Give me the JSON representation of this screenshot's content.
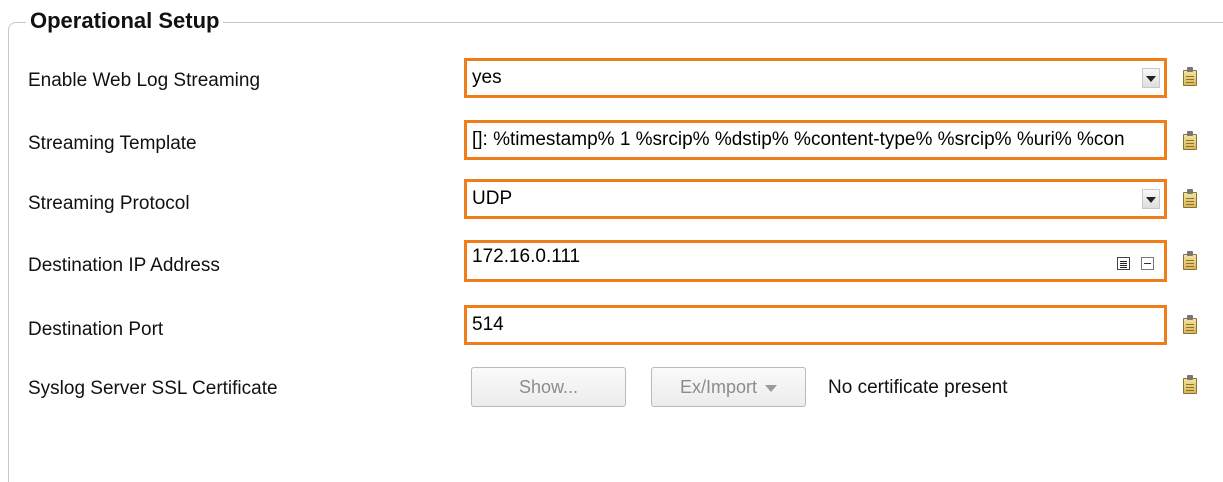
{
  "section": {
    "title": "Operational Setup"
  },
  "fields": {
    "web_log_streaming": {
      "label": "Enable Web Log Streaming",
      "value": "yes"
    },
    "streaming_template": {
      "label": "Streaming Template",
      "value": "[]: %timestamp% 1 %srcip% %dstip% %content-type% %srcip% %uri% %con"
    },
    "streaming_protocol": {
      "label": "Streaming Protocol",
      "value": "UDP"
    },
    "destination_ip": {
      "label": "Destination IP Address",
      "value": "172.16.0.111"
    },
    "destination_port": {
      "label": "Destination Port",
      "value": "514"
    },
    "ssl_certificate": {
      "label": "Syslog Server SSL Certificate",
      "show_button": "Show...",
      "import_button": "Ex/Import",
      "status": "No certificate present"
    }
  },
  "colors": {
    "field_border": "#ef7d1a",
    "disabled_text": "#8c8c8c"
  },
  "icons": {
    "row_icon": "clipboard-icon",
    "dropdown": "chevron-down-icon",
    "list": "list-icon",
    "remove": "minus-icon"
  }
}
